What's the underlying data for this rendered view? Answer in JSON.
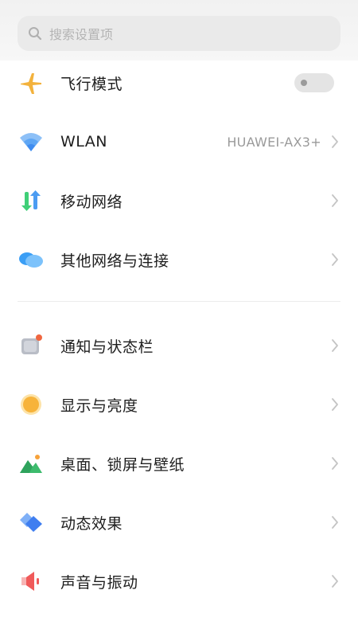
{
  "search": {
    "placeholder": "搜索设置项",
    "icon": "search-icon"
  },
  "settings": {
    "airplane": {
      "label": "飞行模式",
      "icon": "airplane-icon",
      "toggle_on": false
    },
    "wlan": {
      "label": "WLAN",
      "value": "HUAWEI-AX3+",
      "icon": "wifi-icon"
    },
    "mobile": {
      "label": "移动网络",
      "icon": "mobile-network-icon"
    },
    "other_net": {
      "label": "其他网络与连接",
      "icon": "cloud-link-icon"
    },
    "notify": {
      "label": "通知与状态栏",
      "icon": "notification-icon"
    },
    "display": {
      "label": "显示与亮度",
      "icon": "brightness-icon"
    },
    "wallpaper": {
      "label": "桌面、锁屏与壁纸",
      "icon": "wallpaper-icon"
    },
    "animation": {
      "label": "动态效果",
      "icon": "animation-icon"
    },
    "sound": {
      "label": "声音与振动",
      "icon": "sound-icon"
    }
  },
  "colors": {
    "airplane": "#f3b23c",
    "wifi": "#3f8cf0",
    "mobile_green": "#3fcf77",
    "mobile_blue": "#4b9cf2",
    "cloud": "#3a9ef5",
    "notify_gray": "#b9bdc6",
    "notify_dot": "#f0663f",
    "sun": "#f7b33a",
    "mountain_green": "#3dbb6d",
    "animation_blue": "#3f7ef0",
    "sound_red": "#f05a5a"
  }
}
